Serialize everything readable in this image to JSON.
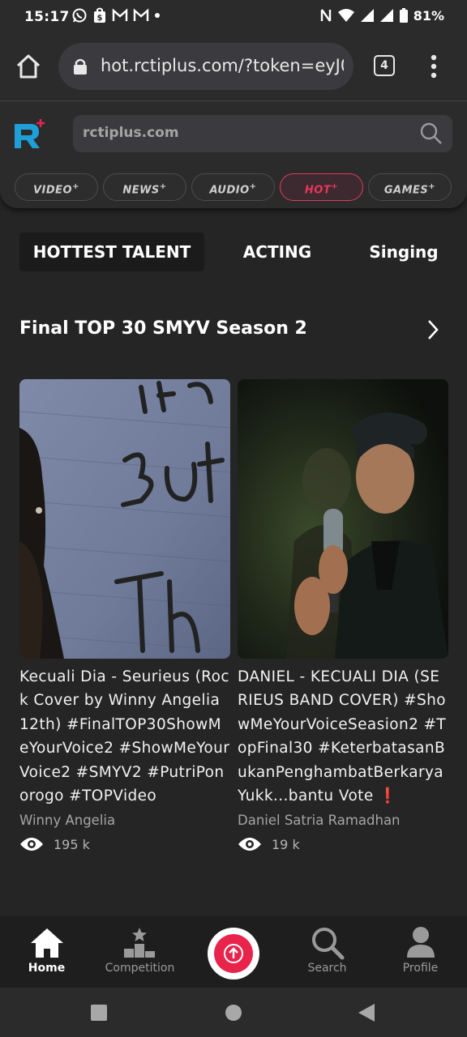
{
  "status_bar": {
    "time": "15:17",
    "battery": "81%"
  },
  "browser": {
    "url": "hot.rctiplus.com/?token=eyJ0",
    "tab_count": "4"
  },
  "site": {
    "search_placeholder": "rctiplus.com",
    "categories": [
      {
        "label": "VIDEO",
        "active": false
      },
      {
        "label": "NEWS",
        "active": false
      },
      {
        "label": "AUDIO",
        "active": false
      },
      {
        "label": "HOT",
        "active": true
      },
      {
        "label": "GAMES",
        "active": false
      }
    ]
  },
  "subtabs": [
    {
      "label": "HOTTEST TALENT",
      "active": true
    },
    {
      "label": "ACTING",
      "active": false
    },
    {
      "label": "Singing",
      "active": false
    }
  ],
  "section": {
    "title": "Final TOP 30 SMYV Season 2"
  },
  "cards": [
    {
      "title": "Kecuali Dia - Seurieus (Rock Cover by Winny Angelia 12th) #FinalTOP30ShowMeYourVoice2 #ShowMeYourVoice2 #SMYV2 #PutriPonorogo #TOPVideo",
      "author": "Winny Angelia",
      "views": "195 k"
    },
    {
      "title": "DANIEL - KECUALI DIA (SERIEUS BAND COVER) #ShowMeYourVoiceSeasion2 #TopFinal30 #KeterbatasanBukanPenghambatBerkarya Yukk...bantu Vote ❗",
      "author": "Daniel Satria Ramadhan",
      "views": "19 k"
    }
  ],
  "bottom_nav": [
    {
      "label": "Home",
      "icon": "home-icon",
      "active": true
    },
    {
      "label": "Competition",
      "icon": "podium-icon",
      "active": false
    },
    {
      "label": "Search",
      "icon": "search-icon",
      "active": false
    },
    {
      "label": "Profile",
      "icon": "profile-icon",
      "active": false
    }
  ],
  "colors": {
    "accent": "#e8244c",
    "background": "#252525"
  }
}
